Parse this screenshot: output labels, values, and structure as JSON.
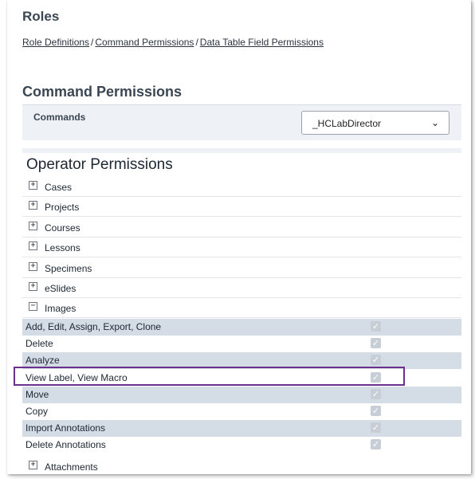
{
  "header": {
    "title": "Roles",
    "breadcrumb": [
      "Role Definitions",
      "Command Permissions",
      "Data Table Field Permissions"
    ],
    "separator": "/"
  },
  "command_permissions": {
    "heading": "Command Permissions",
    "commands_label": "Commands",
    "selected_role": "_HCLabDirector"
  },
  "operator_permissions": {
    "heading": "Operator Permissions",
    "collapsed_sections": [
      "Cases",
      "Projects",
      "Courses",
      "Lessons",
      "Specimens",
      "eSlides"
    ],
    "expanded_section": "Images",
    "image_permissions": [
      {
        "label": "Add, Edit, Assign, Export, Clone",
        "checked": true
      },
      {
        "label": "Delete",
        "checked": true
      },
      {
        "label": "Analyze",
        "checked": true
      },
      {
        "label": "View Label, View Macro",
        "checked": true
      },
      {
        "label": "Move",
        "checked": true
      },
      {
        "label": "Copy",
        "checked": true
      },
      {
        "label": "Import Annotations",
        "checked": true
      },
      {
        "label": "Delete Annotations",
        "checked": true
      }
    ],
    "trailing_section": "Attachments"
  },
  "colors": {
    "highlight": "#6b2f8c",
    "row_shade": "#d4dce6"
  },
  "icons": {
    "expand": "plus-box",
    "collapse": "minus-box",
    "checkbox": "check-mark",
    "dropdown": "chevron-down"
  }
}
